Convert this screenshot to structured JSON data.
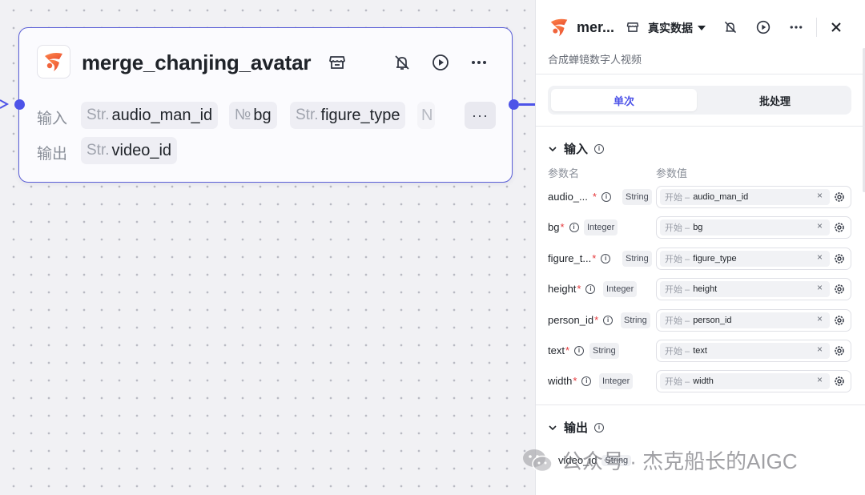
{
  "node": {
    "title": "merge_chanjing_avatar",
    "input_label": "输入",
    "output_label": "输出",
    "inputs": [
      {
        "type": "Str.",
        "name": "audio_man_id"
      },
      {
        "type": "№",
        "name": "bg"
      },
      {
        "type": "Str.",
        "name": "figure_type"
      },
      {
        "type": "",
        "name": "N"
      }
    ],
    "outputs": [
      {
        "type": "Str.",
        "name": "video_id"
      }
    ],
    "more_label": "···"
  },
  "panel": {
    "title": "mer...",
    "mode": "真实数据",
    "description": "合成蝉镜数字人视频",
    "tabs": {
      "single": "单次",
      "batch": "批处理"
    },
    "input_section": "输入",
    "output_section": "输出",
    "col_name": "参数名",
    "col_value": "参数值",
    "source_prefix": "开始 –",
    "clear_glyph": "×",
    "params": [
      {
        "name": "audio_...",
        "type": "String",
        "value": "audio_man_id"
      },
      {
        "name": "bg",
        "type": "Integer",
        "value": "bg"
      },
      {
        "name": "figure_t...",
        "type": "String",
        "value": "figure_type"
      },
      {
        "name": "height",
        "type": "Integer",
        "value": "height"
      },
      {
        "name": "person_id",
        "type": "String",
        "value": "person_id"
      },
      {
        "name": "text",
        "type": "String",
        "value": "text"
      },
      {
        "name": "width",
        "type": "Integer",
        "value": "width"
      }
    ],
    "output_param": {
      "name": "video_id",
      "type": "String"
    }
  },
  "watermark": {
    "text": "公众号 · 杰克船长的AIGC"
  },
  "colors": {
    "accent": "#4d53e8",
    "brand": "#f0643c",
    "required": "#e5383b"
  }
}
